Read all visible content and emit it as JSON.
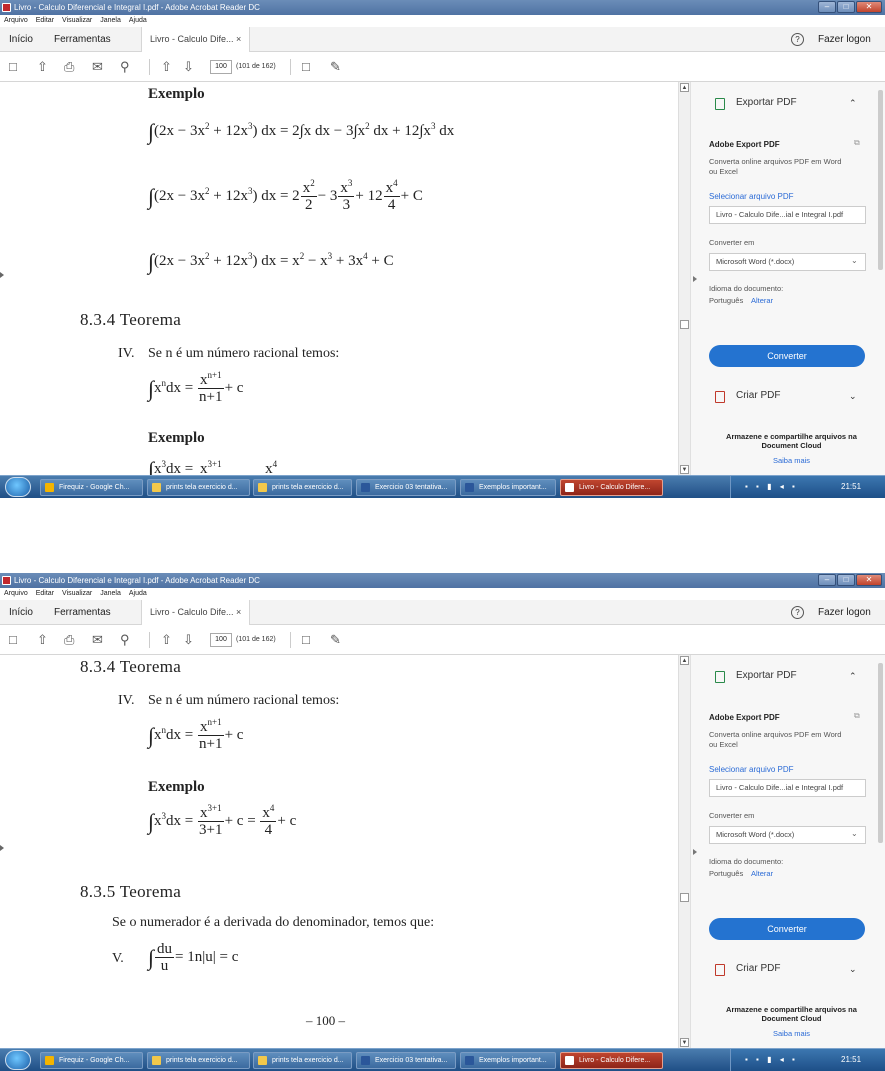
{
  "window": {
    "title": "Livro - Calculo Diferencial e Integral I.pdf - Adobe Acrobat Reader DC",
    "min": "–",
    "max": "□",
    "close": "✕"
  },
  "menu": [
    "Arquivo",
    "Editar",
    "Visualizar",
    "Janela",
    "Ajuda"
  ],
  "tabs": {
    "home": "Início",
    "tools": "Ferramentas",
    "document": "Livro - Calculo Dife...",
    "close": "×",
    "help": "?",
    "login": "Fazer logon"
  },
  "toolbar": {
    "page": "100",
    "page_total": "(101 de 162)"
  },
  "doc_top": {
    "exemplo1": "Exemplo",
    "eq1_lhs": "(2x − 3x",
    "eq1_rhs": "dx = 2∫x dx − 3∫x² dx + 12∫x³ dx",
    "eq2_rhs_a": "dx = 2",
    "eq2_rhs_b": "+ C",
    "eq3_rhs": "dx = x² − x³ + 3x⁴ + C",
    "theorem": "8.3.4 Teorema",
    "iv": "IV.",
    "iv_text": "Se n é um número racional temos:",
    "iv_formula": "x",
    "plus_c": "+ c",
    "exemplo2": "Exemplo"
  },
  "doc_bottom": {
    "theorem1": "8.3.4 Teorema",
    "iv": "IV.",
    "iv_text": "Se n é um número racional temos:",
    "exemplo": "Exemplo",
    "theorem2": "8.3.5 Teorema",
    "v_text": "Se o numerador é a derivada do denominador, temos que:",
    "v": "V.",
    "v_formula": "= 1n|u| = c",
    "page_number": "– 100 –"
  },
  "right_panel": {
    "export_title": "Exportar PDF",
    "adobe_export": "Adobe Export PDF",
    "desc": "Converta online arquivos PDF em Word ou Excel",
    "select_file": "Selecionar arquivo PDF",
    "file_name": "Livro - Calculo Dife...ial e Integral I.pdf",
    "convert_to": "Converter em",
    "format": "Microsoft Word (*.docx)",
    "doc_language": "Idioma do documento:",
    "language": "Português",
    "change": "Alterar",
    "convert_button": "Converter",
    "create_pdf": "Criar PDF",
    "cloud_title": "Armazene e compartilhe arquivos na Document Cloud",
    "learn_more": "Saiba mais"
  },
  "taskbar": {
    "items": [
      "Firequiz - Google Ch...",
      "prints tela exercicio d...",
      "prints tela exercicio d...",
      "Exercicio 03 tentativa...",
      "Exemplos important...",
      "Livro - Calculo Difere..."
    ],
    "clock": "21:51"
  },
  "colors": {
    "accent": "#2473d0",
    "taskbar": "#1f4f86",
    "active_task": "#c0452f"
  }
}
